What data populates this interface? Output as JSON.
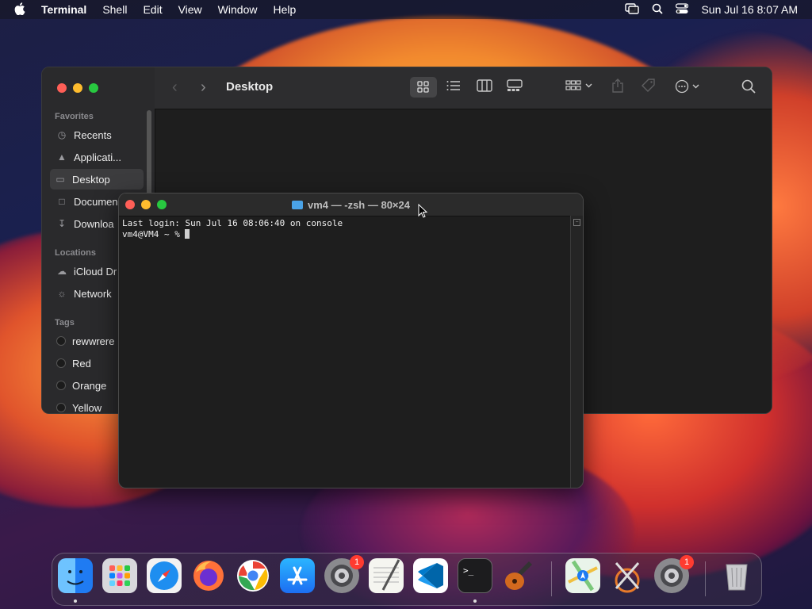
{
  "menubar": {
    "apple": "",
    "app": "Terminal",
    "items": [
      "Shell",
      "Edit",
      "View",
      "Window",
      "Help"
    ],
    "date": "Sun Jul 16",
    "time": "8:07 AM"
  },
  "finder": {
    "title": "Desktop",
    "favorites_header": "Favorites",
    "favorites": [
      "Recents",
      "Applicati...",
      "Desktop",
      "Documen",
      "Downloa"
    ],
    "locations_header": "Locations",
    "locations": [
      "iCloud Dr",
      "Network"
    ],
    "tags_header": "Tags",
    "tags": [
      "rewwrere",
      "Red",
      "Orange",
      "Yellow"
    ]
  },
  "terminal": {
    "title": "vm4 — -zsh — 80×24",
    "line1": "Last login: Sun Jul 16 08:06:40 on console",
    "prompt": "vm4@VM4 ~ % "
  },
  "dock": {
    "apps": [
      "Finder",
      "Launchpad",
      "Safari",
      "Firefox",
      "Chrome",
      "App Store",
      "System Settings",
      "TextEdit",
      "Visual Studio Code",
      "Terminal",
      "GarageBand",
      "Maps",
      "Instruments",
      "System Preferences",
      "Trash"
    ],
    "badges": {
      "settings": "1",
      "prefs": "1"
    }
  },
  "colors": {
    "accent_blue": "#0a84ff",
    "close": "#ff5f57",
    "minimize": "#febc2e",
    "zoom": "#28c840"
  }
}
